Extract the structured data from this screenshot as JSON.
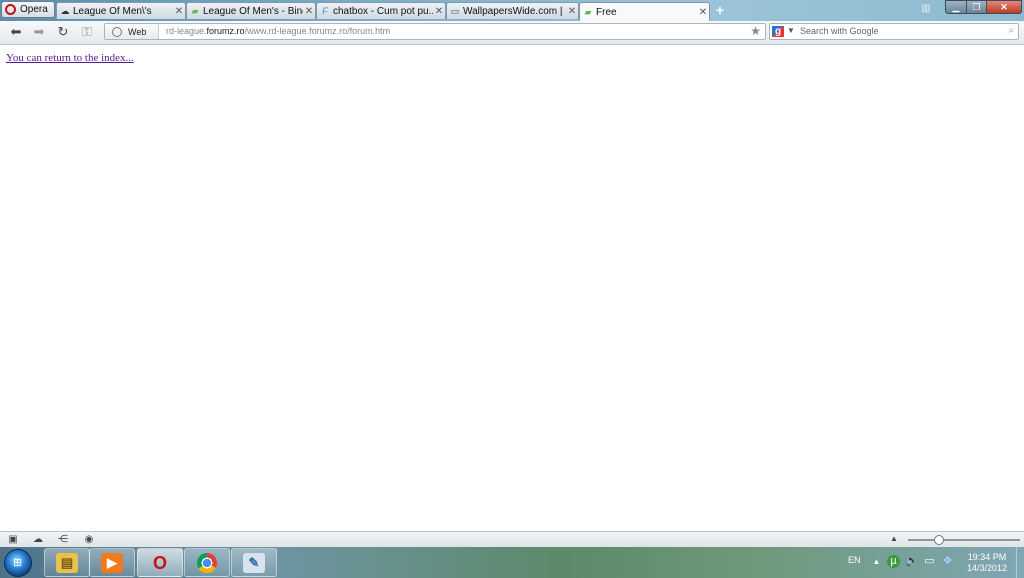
{
  "browser": {
    "menu_label": "Opera",
    "tabs": [
      {
        "label": "League Of Men\\'s",
        "icon": "tab-site-icon",
        "active": false
      },
      {
        "label": "League Of Men's - Bine...",
        "icon": "speech-bubble-icon",
        "active": false
      },
      {
        "label": "chatbox - Cum pot pu...",
        "icon": "forum-icon",
        "active": false
      },
      {
        "label": "WallpapersWide.com | ...",
        "icon": "wallpaper-icon",
        "active": false
      },
      {
        "label": "Free",
        "icon": "speech-bubble-icon",
        "active": true
      }
    ]
  },
  "navbar": {
    "web_badge": "Web",
    "url_prefix": "rd-league.",
    "url_domain": "forumz.ro",
    "url_rest": "/www.rd-league.forumz.ro/forum.htm",
    "search_placeholder": "Search with Google",
    "search_engine_glyph": "g"
  },
  "page": {
    "link_text": "You can return to the index..."
  },
  "statusbar": {
    "zoom_fraction": 0.28
  },
  "taskbar": {
    "language": "EN",
    "time": "19:34 PM",
    "date": "14/3/2012"
  }
}
